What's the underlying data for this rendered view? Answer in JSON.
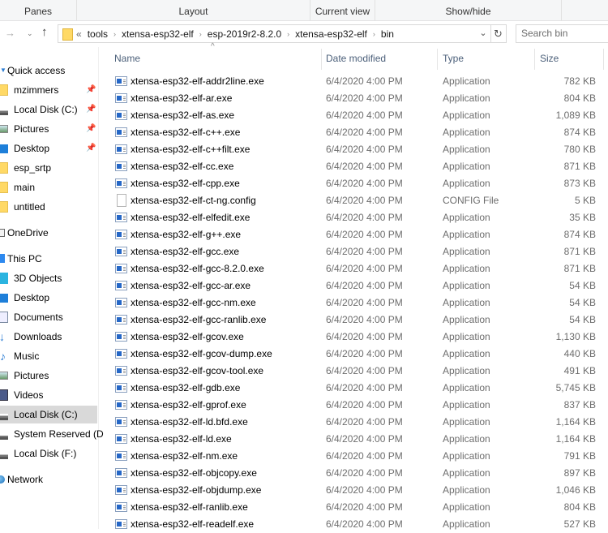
{
  "ribbon": {
    "groups": [
      "Panes",
      "Layout",
      "Current view",
      "Show/hide"
    ]
  },
  "nav": {
    "back_icon": "arrow-left-icon",
    "forward_icon": "arrow-right-icon",
    "recent_icon": "chevron-down-icon",
    "up_icon": "arrow-up-icon"
  },
  "address": {
    "overflow": "«",
    "crumbs": [
      "tools",
      "xtensa-esp32-elf",
      "esp-2019r2-8.2.0",
      "xtensa-esp32-elf",
      "bin"
    ],
    "dropdown_icon": "chevron-down-icon",
    "refresh_icon": "refresh-icon"
  },
  "search": {
    "placeholder": "Search bin"
  },
  "sidebar": {
    "quick_access": {
      "label": "Quick access",
      "items": [
        {
          "label": "mzimmers",
          "icon": "folder-icon",
          "pinned": true
        },
        {
          "label": "Local Disk (C:)",
          "icon": "drive-icon",
          "pinned": true
        },
        {
          "label": "Pictures",
          "icon": "pictures-icon",
          "pinned": true
        },
        {
          "label": "Desktop",
          "icon": "desktop-icon",
          "pinned": true
        },
        {
          "label": "esp_srtp",
          "icon": "folder-icon",
          "pinned": false
        },
        {
          "label": "main",
          "icon": "folder-icon",
          "pinned": false
        },
        {
          "label": "untitled",
          "icon": "folder-icon",
          "pinned": false
        }
      ]
    },
    "onedrive": {
      "label": "OneDrive"
    },
    "this_pc": {
      "label": "This PC",
      "items": [
        {
          "label": "3D Objects",
          "icon": "3d-objects-icon"
        },
        {
          "label": "Desktop",
          "icon": "desktop-icon"
        },
        {
          "label": "Documents",
          "icon": "documents-icon"
        },
        {
          "label": "Downloads",
          "icon": "downloads-icon"
        },
        {
          "label": "Music",
          "icon": "music-icon"
        },
        {
          "label": "Pictures",
          "icon": "pictures-icon"
        },
        {
          "label": "Videos",
          "icon": "videos-icon"
        },
        {
          "label": "Local Disk (C:)",
          "icon": "drive-icon",
          "selected": true
        },
        {
          "label": "System Reserved (D",
          "icon": "drive-icon"
        },
        {
          "label": "Local Disk (F:)",
          "icon": "drive-icon"
        }
      ]
    },
    "network": {
      "label": "Network"
    }
  },
  "columns": {
    "name": "Name",
    "date": "Date modified",
    "type": "Type",
    "size": "Size"
  },
  "files": [
    {
      "name": "xtensa-esp32-elf-addr2line.exe",
      "date": "6/4/2020 4:00 PM",
      "type": "Application",
      "size": "782 KB",
      "kind": "exe"
    },
    {
      "name": "xtensa-esp32-elf-ar.exe",
      "date": "6/4/2020 4:00 PM",
      "type": "Application",
      "size": "804 KB",
      "kind": "exe"
    },
    {
      "name": "xtensa-esp32-elf-as.exe",
      "date": "6/4/2020 4:00 PM",
      "type": "Application",
      "size": "1,089 KB",
      "kind": "exe"
    },
    {
      "name": "xtensa-esp32-elf-c++.exe",
      "date": "6/4/2020 4:00 PM",
      "type": "Application",
      "size": "874 KB",
      "kind": "exe"
    },
    {
      "name": "xtensa-esp32-elf-c++filt.exe",
      "date": "6/4/2020 4:00 PM",
      "type": "Application",
      "size": "780 KB",
      "kind": "exe"
    },
    {
      "name": "xtensa-esp32-elf-cc.exe",
      "date": "6/4/2020 4:00 PM",
      "type": "Application",
      "size": "871 KB",
      "kind": "exe"
    },
    {
      "name": "xtensa-esp32-elf-cpp.exe",
      "date": "6/4/2020 4:00 PM",
      "type": "Application",
      "size": "873 KB",
      "kind": "exe"
    },
    {
      "name": "xtensa-esp32-elf-ct-ng.config",
      "date": "6/4/2020 4:00 PM",
      "type": "CONFIG File",
      "size": "5 KB",
      "kind": "file"
    },
    {
      "name": "xtensa-esp32-elf-elfedit.exe",
      "date": "6/4/2020 4:00 PM",
      "type": "Application",
      "size": "35 KB",
      "kind": "exe"
    },
    {
      "name": "xtensa-esp32-elf-g++.exe",
      "date": "6/4/2020 4:00 PM",
      "type": "Application",
      "size": "874 KB",
      "kind": "exe"
    },
    {
      "name": "xtensa-esp32-elf-gcc.exe",
      "date": "6/4/2020 4:00 PM",
      "type": "Application",
      "size": "871 KB",
      "kind": "exe"
    },
    {
      "name": "xtensa-esp32-elf-gcc-8.2.0.exe",
      "date": "6/4/2020 4:00 PM",
      "type": "Application",
      "size": "871 KB",
      "kind": "exe"
    },
    {
      "name": "xtensa-esp32-elf-gcc-ar.exe",
      "date": "6/4/2020 4:00 PM",
      "type": "Application",
      "size": "54 KB",
      "kind": "exe"
    },
    {
      "name": "xtensa-esp32-elf-gcc-nm.exe",
      "date": "6/4/2020 4:00 PM",
      "type": "Application",
      "size": "54 KB",
      "kind": "exe"
    },
    {
      "name": "xtensa-esp32-elf-gcc-ranlib.exe",
      "date": "6/4/2020 4:00 PM",
      "type": "Application",
      "size": "54 KB",
      "kind": "exe"
    },
    {
      "name": "xtensa-esp32-elf-gcov.exe",
      "date": "6/4/2020 4:00 PM",
      "type": "Application",
      "size": "1,130 KB",
      "kind": "exe"
    },
    {
      "name": "xtensa-esp32-elf-gcov-dump.exe",
      "date": "6/4/2020 4:00 PM",
      "type": "Application",
      "size": "440 KB",
      "kind": "exe"
    },
    {
      "name": "xtensa-esp32-elf-gcov-tool.exe",
      "date": "6/4/2020 4:00 PM",
      "type": "Application",
      "size": "491 KB",
      "kind": "exe"
    },
    {
      "name": "xtensa-esp32-elf-gdb.exe",
      "date": "6/4/2020 4:00 PM",
      "type": "Application",
      "size": "5,745 KB",
      "kind": "exe"
    },
    {
      "name": "xtensa-esp32-elf-gprof.exe",
      "date": "6/4/2020 4:00 PM",
      "type": "Application",
      "size": "837 KB",
      "kind": "exe"
    },
    {
      "name": "xtensa-esp32-elf-ld.bfd.exe",
      "date": "6/4/2020 4:00 PM",
      "type": "Application",
      "size": "1,164 KB",
      "kind": "exe"
    },
    {
      "name": "xtensa-esp32-elf-ld.exe",
      "date": "6/4/2020 4:00 PM",
      "type": "Application",
      "size": "1,164 KB",
      "kind": "exe"
    },
    {
      "name": "xtensa-esp32-elf-nm.exe",
      "date": "6/4/2020 4:00 PM",
      "type": "Application",
      "size": "791 KB",
      "kind": "exe"
    },
    {
      "name": "xtensa-esp32-elf-objcopy.exe",
      "date": "6/4/2020 4:00 PM",
      "type": "Application",
      "size": "897 KB",
      "kind": "exe"
    },
    {
      "name": "xtensa-esp32-elf-objdump.exe",
      "date": "6/4/2020 4:00 PM",
      "type": "Application",
      "size": "1,046 KB",
      "kind": "exe"
    },
    {
      "name": "xtensa-esp32-elf-ranlib.exe",
      "date": "6/4/2020 4:00 PM",
      "type": "Application",
      "size": "804 KB",
      "kind": "exe"
    },
    {
      "name": "xtensa-esp32-elf-readelf.exe",
      "date": "6/4/2020 4:00 PM",
      "type": "Application",
      "size": "527 KB",
      "kind": "exe"
    }
  ]
}
